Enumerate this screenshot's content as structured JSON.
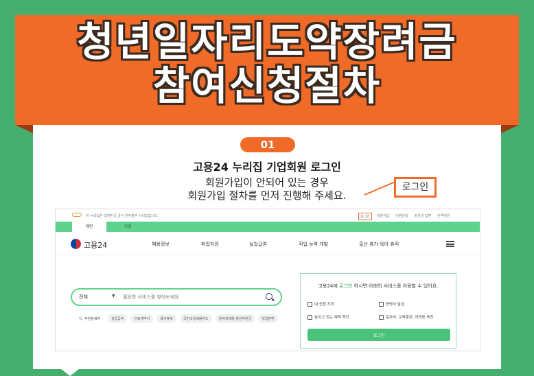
{
  "banner": {
    "line1": "청년일자리도약장려금",
    "line2": "참여신청절차"
  },
  "step": {
    "number": "01",
    "title": "고용24 누리집 기업회원 로그인",
    "desc_line1": "회원가입이 안되어 있는 경우",
    "desc_line2": "회원가입 절차를 먼저 진행해 주세요.",
    "callout": "로그인"
  },
  "site": {
    "notice": "이 누리집은 대한민국 공식 전자정부 누리집입니다.",
    "util_links": [
      "로그인",
      "회원가입",
      "이용안내",
      "질문과 답변",
      "원격지원"
    ],
    "tabs": [
      "개인",
      "기업"
    ],
    "brand": "고용24",
    "menu": [
      "채용정보",
      "취업지원",
      "실업급여",
      "직업 능력 개발",
      "출산 휴가·육아 휴직"
    ],
    "search": {
      "scope": "전체",
      "placeholder": "필요한 서비스를 찾아보세요"
    },
    "recommend_label": "추천검색어",
    "chips": [
      "실업급여",
      "근로계약서",
      "육아휴직",
      "국민내일배움카드",
      "일자리채움 청년지원금",
      "직업훈련"
    ],
    "panel": {
      "pre": "고용24에 ",
      "highlight": "로그인",
      "post": " 하시면 아래의 서비스를 이용할 수 있어요.",
      "items": [
        "내 신청 조회",
        "증명서 발급",
        "놓치고 있는 혜택 확인",
        "일자리, 교육훈련, 자격증 추천"
      ],
      "login_button": "로그인"
    }
  },
  "colors": {
    "background": "#45ad6e",
    "banner": "#f06a28",
    "tab_green": "#5fd38d",
    "button_green": "#4ac27a"
  }
}
